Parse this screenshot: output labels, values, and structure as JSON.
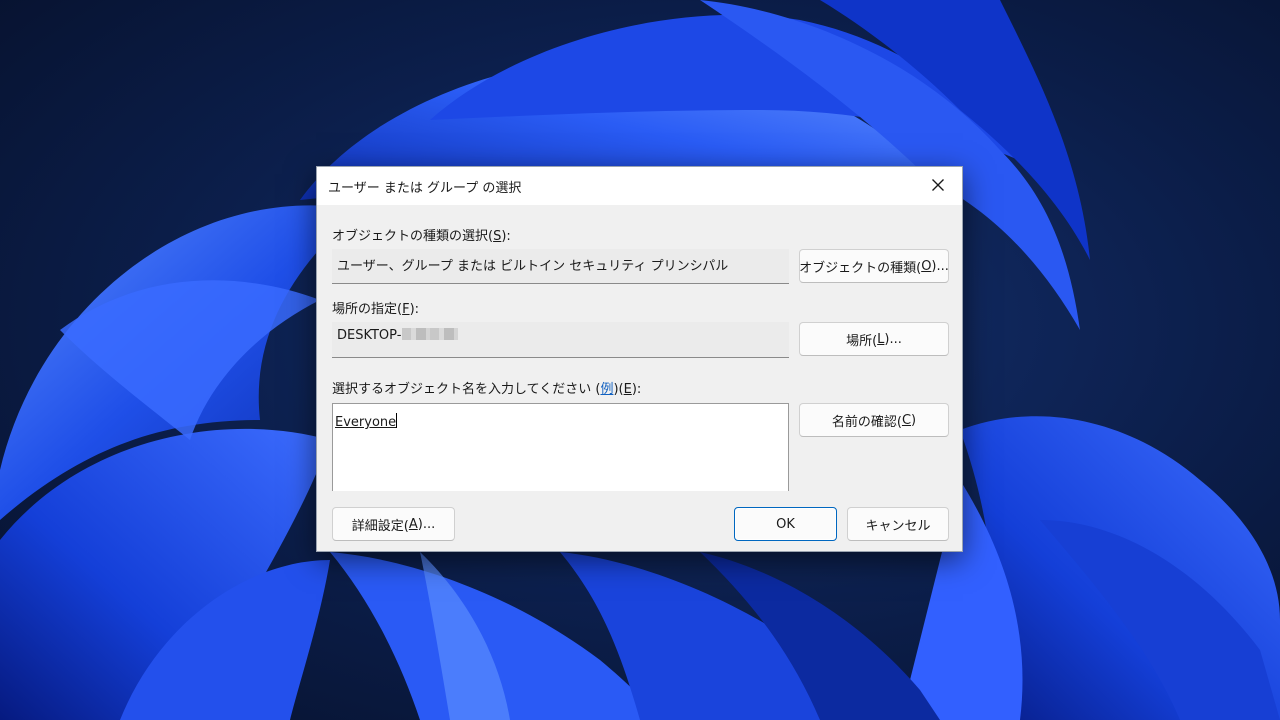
{
  "dialog": {
    "title": "ユーザー または グループ の選択",
    "object_type_label_pre": "オブジェクトの種類の選択(",
    "object_type_label_key": "S",
    "object_type_label_post": "):",
    "object_type_value": "ユーザー、グループ または ビルトイン セキュリティ プリンシパル",
    "object_type_button_pre": "オブジェクトの種類(",
    "object_type_button_key": "O",
    "object_type_button_post": ")...",
    "location_label_pre": "場所の指定(",
    "location_label_key": "F",
    "location_label_post": "):",
    "location_value": "DESKTOP-",
    "location_button_pre": "場所(",
    "location_button_key": "L",
    "location_button_post": ")...",
    "names_label_pre": "選択するオブジェクト名を入力してください (",
    "names_label_link": "例",
    "names_label_mid": ")(",
    "names_label_key": "E",
    "names_label_post": "):",
    "names_input_value": "Everyone",
    "check_names_button_pre": "名前の確認(",
    "check_names_button_key": "C",
    "check_names_button_post": ")",
    "advanced_button_pre": "詳細設定(",
    "advanced_button_key": "A",
    "advanced_button_post": ")...",
    "ok_label": "OK",
    "cancel_label": "キャンセル"
  },
  "icons": {
    "close": "close-icon"
  },
  "colors": {
    "accent": "#0067c0",
    "link": "#1060c0",
    "dialog_bg": "#f0f0f0"
  }
}
